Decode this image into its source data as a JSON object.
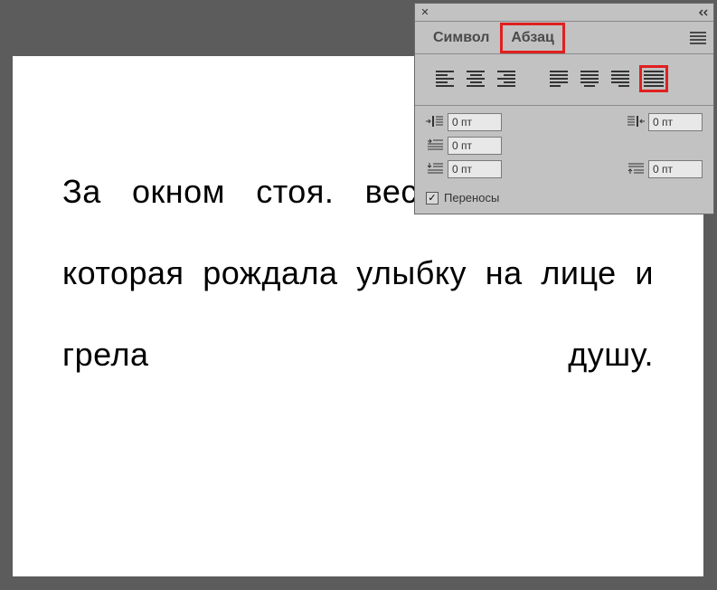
{
  "document": {
    "text": "За окном стоя. весенняя погода, которая рождала улыбку на лице и грела душу."
  },
  "panel": {
    "tabs": {
      "character": "Символ",
      "paragraph": "Абзац"
    },
    "indents": {
      "left": "0 пт",
      "right": "0 пт",
      "first_line": "0 пт",
      "space_before": "0 пт",
      "space_after": "0 пт"
    },
    "hyphenation": {
      "label": "Переносы",
      "checked": true
    },
    "highlights": {
      "active_tab": "paragraph",
      "active_alignment": "justify-all"
    }
  }
}
